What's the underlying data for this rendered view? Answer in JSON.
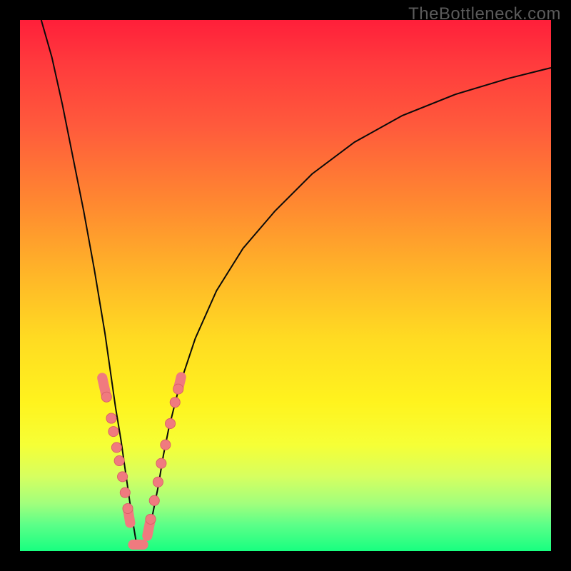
{
  "watermark": {
    "text": "TheBottleneck.com"
  },
  "colors": {
    "curve": "#0a0a0a",
    "marker_fill": "#f07a7f",
    "marker_stroke": "#d85e66",
    "bg_top": "#ff1f3a",
    "bg_bottom": "#18ff80"
  },
  "chart_data": {
    "type": "line",
    "title": "",
    "xlabel": "",
    "ylabel": "",
    "xlim": [
      0,
      100
    ],
    "ylim": [
      0,
      100
    ],
    "note": "Bottleneck-style V curve; y read as percentage height from bottom. Dip at x≈22.",
    "series": [
      {
        "name": "bottleneck-curve",
        "x": [
          4,
          6,
          8,
          10,
          12,
          14,
          16,
          18,
          19,
          20,
          21,
          22,
          23,
          24,
          25,
          26,
          27,
          28,
          30,
          33,
          37,
          42,
          48,
          55,
          63,
          72,
          82,
          92,
          100
        ],
        "values": [
          100,
          93,
          84,
          74,
          64,
          53,
          41,
          27,
          21,
          14,
          7,
          1,
          1,
          3,
          7,
          12,
          18,
          23,
          31,
          40,
          49,
          57,
          64,
          71,
          77,
          82,
          86,
          89,
          91
        ]
      }
    ],
    "markers": [
      {
        "name": "left-dot-cluster",
        "shape": "pill-and-dots",
        "x": [
          16.3,
          17.2,
          17.6,
          18.2,
          18.7,
          19.3,
          19.8,
          20.3
        ],
        "values": [
          29,
          25,
          22.5,
          19.5,
          17,
          14,
          11,
          8
        ]
      },
      {
        "name": "valley-pill",
        "shape": "pill",
        "x": [
          21.3,
          23.2
        ],
        "values": [
          1.2,
          1.2
        ]
      },
      {
        "name": "right-dot-cluster",
        "shape": "pill-and-dots",
        "x": [
          24.6,
          25.3,
          26.0,
          26.6,
          27.4,
          28.3,
          29.2,
          29.8
        ],
        "values": [
          6,
          9.5,
          13,
          16.5,
          20,
          24,
          28,
          30.5
        ]
      }
    ]
  }
}
